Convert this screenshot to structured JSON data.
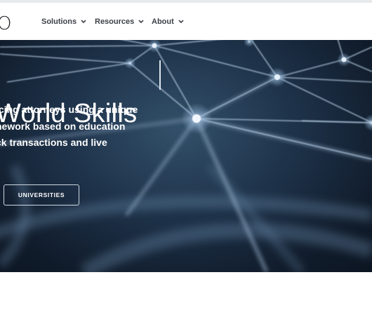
{
  "header": {
    "logo_text": "O",
    "nav": [
      {
        "label": "Solutions",
        "icon": "chevron-down-icon"
      },
      {
        "label": "Resources",
        "icon": "chevron-down-icon"
      },
      {
        "label": "About",
        "icon": "chevron-down-icon"
      }
    ]
  },
  "hero": {
    "headline": "World Skills",
    "body_lines": [
      "icing attorneys using a unique",
      "nework based on education",
      "ck transactions and live"
    ],
    "button_label": "UNIVERSITIES",
    "background_image": "network-nodes-image"
  },
  "colors": {
    "nav_text": "#3d4148",
    "hero_dark": "#101b2a",
    "hero_mid": "#33506a",
    "button_border": "#cfd8e2"
  }
}
